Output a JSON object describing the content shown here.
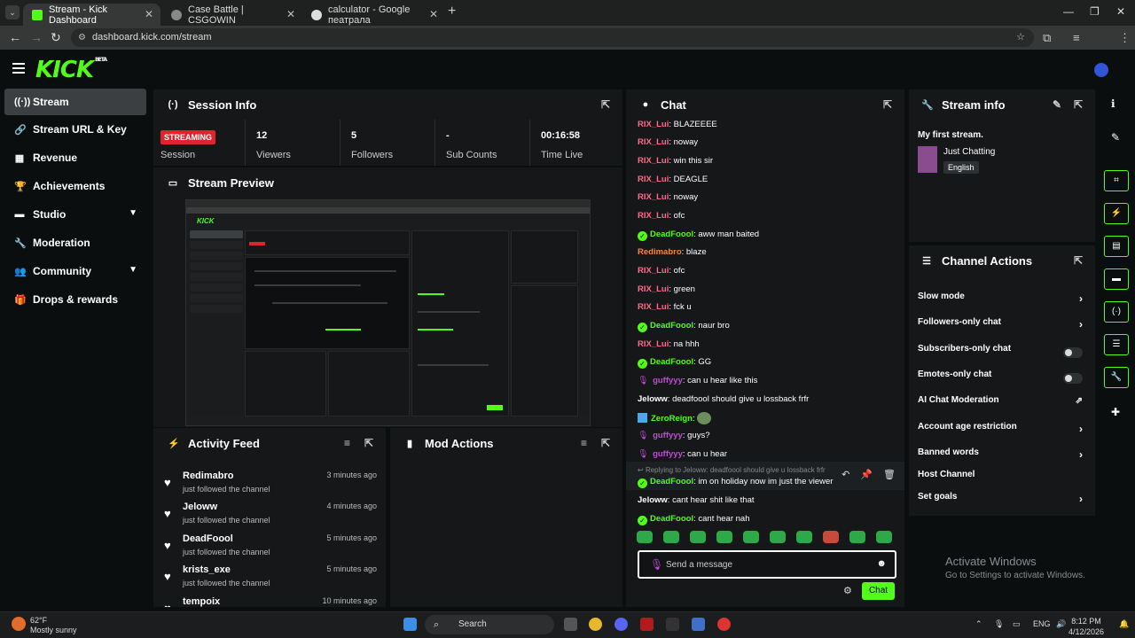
{
  "browser": {
    "tabs": [
      {
        "title": "Stream - Kick Dashboard",
        "active": true
      },
      {
        "title": "Case Battle | CSGOWIN",
        "active": false
      },
      {
        "title": "calculator - Google пеатрала",
        "active": false
      }
    ],
    "url": "dashboard.kick.com/stream"
  },
  "app": {
    "logo": "KICK",
    "logo_badge": "BETA"
  },
  "sidebar": {
    "items": [
      {
        "label": "Stream",
        "icon": "broadcast-icon",
        "active": true
      },
      {
        "label": "Stream URL & Key",
        "icon": "link-icon"
      },
      {
        "label": "Revenue",
        "icon": "chart-icon"
      },
      {
        "label": "Achievements",
        "icon": "trophy-icon"
      },
      {
        "label": "Studio",
        "icon": "folder-icon",
        "expandable": true
      },
      {
        "label": "Moderation",
        "icon": "wrench-icon"
      },
      {
        "label": "Community",
        "icon": "people-icon",
        "expandable": true
      },
      {
        "label": "Drops & rewards",
        "icon": "gift-icon"
      }
    ]
  },
  "session": {
    "title": "Session Info",
    "status": "STREAMING",
    "status_label": "Session",
    "stats": [
      {
        "value": "12",
        "label": "Viewers"
      },
      {
        "value": "5",
        "label": "Followers"
      },
      {
        "value": "-",
        "label": "Sub Counts"
      },
      {
        "value": "00:16:58",
        "label": "Time Live"
      }
    ]
  },
  "preview": {
    "title": "Stream Preview"
  },
  "activity": {
    "title": "Activity Feed",
    "items": [
      {
        "name": "Redimabro",
        "sub": "just followed the channel",
        "time": "3 minutes ago"
      },
      {
        "name": "Jeloww",
        "sub": "just followed the channel",
        "time": "4 minutes ago"
      },
      {
        "name": "DeadFoool",
        "sub": "just followed the channel",
        "time": "5 minutes ago"
      },
      {
        "name": "krists_exe",
        "sub": "just followed the channel",
        "time": "5 minutes ago"
      },
      {
        "name": "tempoix",
        "sub": "",
        "time": "10 minutes ago"
      }
    ]
  },
  "mod_actions": {
    "title": "Mod Actions"
  },
  "chat": {
    "title": "Chat",
    "messages": [
      {
        "user": "RIX_Lui",
        "text": ": BLAZEEEE",
        "color": "#ff6b8b"
      },
      {
        "user": "RIX_Lui",
        "text": ": noway",
        "color": "#ff6b8b"
      },
      {
        "user": "RIX_Lui",
        "text": ": win this sir",
        "color": "#ff6b8b"
      },
      {
        "user": "RIX_Lui",
        "text": ": DEAGLE",
        "color": "#ff6b8b"
      },
      {
        "user": "RIX_Lui",
        "text": ": noway",
        "color": "#ff6b8b"
      },
      {
        "user": "RIX_Lui",
        "text": ": ofc",
        "color": "#ff6b8b"
      },
      {
        "user": "DeadFoool",
        "text": ": aww man baited",
        "color": "#53fc18",
        "verified": true
      },
      {
        "user": "Redimabro",
        "text": ": blaze",
        "color": "#f08a3c"
      },
      {
        "user": "RIX_Lui",
        "text": ": ofc",
        "color": "#ff6b8b"
      },
      {
        "user": "RIX_Lui",
        "text": ": green",
        "color": "#ff6b8b"
      },
      {
        "user": "RIX_Lui",
        "text": ": fck u",
        "color": "#ff6b8b"
      },
      {
        "user": "DeadFoool",
        "text": ": naur bro",
        "color": "#53fc18",
        "verified": true
      },
      {
        "user": "RIX_Lui",
        "text": ": na hhh",
        "color": "#ff6b8b"
      },
      {
        "user": "DeadFoool",
        "text": ": GG",
        "color": "#53fc18",
        "verified": true
      },
      {
        "user": "guffyyy",
        "text": ": can u hear like this",
        "color": "#c04bd7",
        "mic": true
      },
      {
        "user": "Jeloww",
        "text": ": deadfoool should give u lossback frfr",
        "color": "#ffffff"
      },
      {
        "user": "ZeroReign",
        "text": ": ",
        "color": "#53fc18",
        "zr": true,
        "emote": true
      },
      {
        "user": "guffyyy",
        "text": ": guys?",
        "color": "#c04bd7",
        "mic": true
      },
      {
        "user": "guffyyy",
        "text": ": can u hear",
        "color": "#c04bd7",
        "mic": true
      },
      {
        "user": "DeadFoool",
        "text": ": im on holiday now im just the viewer",
        "color": "#53fc18",
        "verified": true
      },
      {
        "user": "Jeloww",
        "text": ": cant hear shit like that",
        "color": "#ffffff"
      },
      {
        "user": "DeadFoool",
        "text": ": cant hear nah",
        "color": "#53fc18",
        "verified": true
      }
    ],
    "reply_hint": "Replying to Jeloww: deadfoool should give u lossback frfr",
    "input_placeholder": "Send a message",
    "send_label": "Chat"
  },
  "stream_info": {
    "title": "Stream info",
    "stream_title": "My first stream.",
    "category": "Just Chatting",
    "language": "English"
  },
  "channel_actions": {
    "title": "Channel Actions",
    "items": [
      {
        "label": "Slow mode",
        "control": "chevron"
      },
      {
        "label": "Followers-only chat",
        "control": "chevron"
      },
      {
        "label": "Subscribers-only chat",
        "control": "toggle"
      },
      {
        "label": "Emotes-only chat",
        "control": "toggle"
      },
      {
        "label": "AI Chat Moderation",
        "control": "external"
      },
      {
        "label": "Account age restriction",
        "control": "chevron"
      },
      {
        "label": "Banned words",
        "control": "chevron"
      },
      {
        "label": "Host Channel",
        "control": "none"
      },
      {
        "label": "Set goals",
        "control": "chevron"
      }
    ]
  },
  "watermark": {
    "line1": "Activate Windows",
    "line2": "Go to Settings to activate Windows."
  },
  "taskbar": {
    "temp": "62°F",
    "weather": "Mostly sunny",
    "search": "Search",
    "lang": "ENG",
    "time": "8:12 PM",
    "date": "4/12/2026"
  }
}
